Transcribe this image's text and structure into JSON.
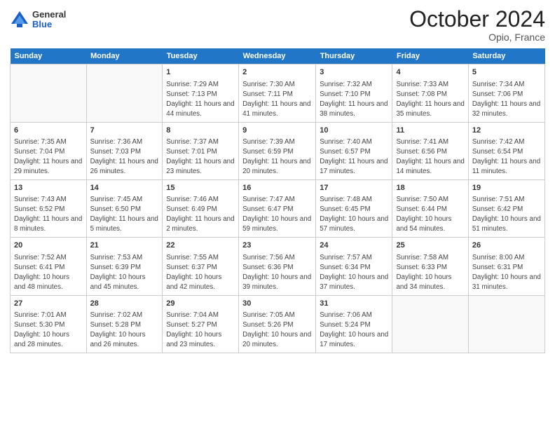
{
  "header": {
    "logo_general": "General",
    "logo_blue": "Blue",
    "month": "October 2024",
    "location": "Opio, France"
  },
  "days_of_week": [
    "Sunday",
    "Monday",
    "Tuesday",
    "Wednesday",
    "Thursday",
    "Friday",
    "Saturday"
  ],
  "weeks": [
    [
      {
        "day": "",
        "sunrise": "",
        "sunset": "",
        "daylight": ""
      },
      {
        "day": "",
        "sunrise": "",
        "sunset": "",
        "daylight": ""
      },
      {
        "day": "1",
        "sunrise": "Sunrise: 7:29 AM",
        "sunset": "Sunset: 7:13 PM",
        "daylight": "Daylight: 11 hours and 44 minutes."
      },
      {
        "day": "2",
        "sunrise": "Sunrise: 7:30 AM",
        "sunset": "Sunset: 7:11 PM",
        "daylight": "Daylight: 11 hours and 41 minutes."
      },
      {
        "day": "3",
        "sunrise": "Sunrise: 7:32 AM",
        "sunset": "Sunset: 7:10 PM",
        "daylight": "Daylight: 11 hours and 38 minutes."
      },
      {
        "day": "4",
        "sunrise": "Sunrise: 7:33 AM",
        "sunset": "Sunset: 7:08 PM",
        "daylight": "Daylight: 11 hours and 35 minutes."
      },
      {
        "day": "5",
        "sunrise": "Sunrise: 7:34 AM",
        "sunset": "Sunset: 7:06 PM",
        "daylight": "Daylight: 11 hours and 32 minutes."
      }
    ],
    [
      {
        "day": "6",
        "sunrise": "Sunrise: 7:35 AM",
        "sunset": "Sunset: 7:04 PM",
        "daylight": "Daylight: 11 hours and 29 minutes."
      },
      {
        "day": "7",
        "sunrise": "Sunrise: 7:36 AM",
        "sunset": "Sunset: 7:03 PM",
        "daylight": "Daylight: 11 hours and 26 minutes."
      },
      {
        "day": "8",
        "sunrise": "Sunrise: 7:37 AM",
        "sunset": "Sunset: 7:01 PM",
        "daylight": "Daylight: 11 hours and 23 minutes."
      },
      {
        "day": "9",
        "sunrise": "Sunrise: 7:39 AM",
        "sunset": "Sunset: 6:59 PM",
        "daylight": "Daylight: 11 hours and 20 minutes."
      },
      {
        "day": "10",
        "sunrise": "Sunrise: 7:40 AM",
        "sunset": "Sunset: 6:57 PM",
        "daylight": "Daylight: 11 hours and 17 minutes."
      },
      {
        "day": "11",
        "sunrise": "Sunrise: 7:41 AM",
        "sunset": "Sunset: 6:56 PM",
        "daylight": "Daylight: 11 hours and 14 minutes."
      },
      {
        "day": "12",
        "sunrise": "Sunrise: 7:42 AM",
        "sunset": "Sunset: 6:54 PM",
        "daylight": "Daylight: 11 hours and 11 minutes."
      }
    ],
    [
      {
        "day": "13",
        "sunrise": "Sunrise: 7:43 AM",
        "sunset": "Sunset: 6:52 PM",
        "daylight": "Daylight: 11 hours and 8 minutes."
      },
      {
        "day": "14",
        "sunrise": "Sunrise: 7:45 AM",
        "sunset": "Sunset: 6:50 PM",
        "daylight": "Daylight: 11 hours and 5 minutes."
      },
      {
        "day": "15",
        "sunrise": "Sunrise: 7:46 AM",
        "sunset": "Sunset: 6:49 PM",
        "daylight": "Daylight: 11 hours and 2 minutes."
      },
      {
        "day": "16",
        "sunrise": "Sunrise: 7:47 AM",
        "sunset": "Sunset: 6:47 PM",
        "daylight": "Daylight: 10 hours and 59 minutes."
      },
      {
        "day": "17",
        "sunrise": "Sunrise: 7:48 AM",
        "sunset": "Sunset: 6:45 PM",
        "daylight": "Daylight: 10 hours and 57 minutes."
      },
      {
        "day": "18",
        "sunrise": "Sunrise: 7:50 AM",
        "sunset": "Sunset: 6:44 PM",
        "daylight": "Daylight: 10 hours and 54 minutes."
      },
      {
        "day": "19",
        "sunrise": "Sunrise: 7:51 AM",
        "sunset": "Sunset: 6:42 PM",
        "daylight": "Daylight: 10 hours and 51 minutes."
      }
    ],
    [
      {
        "day": "20",
        "sunrise": "Sunrise: 7:52 AM",
        "sunset": "Sunset: 6:41 PM",
        "daylight": "Daylight: 10 hours and 48 minutes."
      },
      {
        "day": "21",
        "sunrise": "Sunrise: 7:53 AM",
        "sunset": "Sunset: 6:39 PM",
        "daylight": "Daylight: 10 hours and 45 minutes."
      },
      {
        "day": "22",
        "sunrise": "Sunrise: 7:55 AM",
        "sunset": "Sunset: 6:37 PM",
        "daylight": "Daylight: 10 hours and 42 minutes."
      },
      {
        "day": "23",
        "sunrise": "Sunrise: 7:56 AM",
        "sunset": "Sunset: 6:36 PM",
        "daylight": "Daylight: 10 hours and 39 minutes."
      },
      {
        "day": "24",
        "sunrise": "Sunrise: 7:57 AM",
        "sunset": "Sunset: 6:34 PM",
        "daylight": "Daylight: 10 hours and 37 minutes."
      },
      {
        "day": "25",
        "sunrise": "Sunrise: 7:58 AM",
        "sunset": "Sunset: 6:33 PM",
        "daylight": "Daylight: 10 hours and 34 minutes."
      },
      {
        "day": "26",
        "sunrise": "Sunrise: 8:00 AM",
        "sunset": "Sunset: 6:31 PM",
        "daylight": "Daylight: 10 hours and 31 minutes."
      }
    ],
    [
      {
        "day": "27",
        "sunrise": "Sunrise: 7:01 AM",
        "sunset": "Sunset: 5:30 PM",
        "daylight": "Daylight: 10 hours and 28 minutes."
      },
      {
        "day": "28",
        "sunrise": "Sunrise: 7:02 AM",
        "sunset": "Sunset: 5:28 PM",
        "daylight": "Daylight: 10 hours and 26 minutes."
      },
      {
        "day": "29",
        "sunrise": "Sunrise: 7:04 AM",
        "sunset": "Sunset: 5:27 PM",
        "daylight": "Daylight: 10 hours and 23 minutes."
      },
      {
        "day": "30",
        "sunrise": "Sunrise: 7:05 AM",
        "sunset": "Sunset: 5:26 PM",
        "daylight": "Daylight: 10 hours and 20 minutes."
      },
      {
        "day": "31",
        "sunrise": "Sunrise: 7:06 AM",
        "sunset": "Sunset: 5:24 PM",
        "daylight": "Daylight: 10 hours and 17 minutes."
      },
      {
        "day": "",
        "sunrise": "",
        "sunset": "",
        "daylight": ""
      },
      {
        "day": "",
        "sunrise": "",
        "sunset": "",
        "daylight": ""
      }
    ]
  ]
}
